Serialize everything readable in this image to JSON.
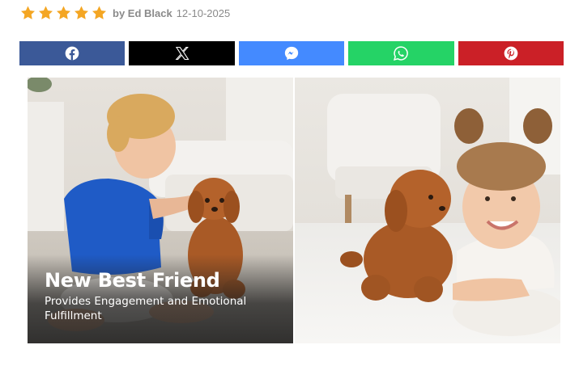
{
  "review": {
    "rating": 5,
    "rating_max": 5,
    "author": "by Ed Black",
    "date": "12-10-2025",
    "star_color": "#f4a623"
  },
  "share": {
    "buttons": [
      {
        "name": "facebook",
        "icon": "facebook-icon",
        "color": "#3b5998"
      },
      {
        "name": "x",
        "icon": "x-icon",
        "color": "#000000"
      },
      {
        "name": "messenger",
        "icon": "messenger-icon",
        "color": "#448aff"
      },
      {
        "name": "whatsapp",
        "icon": "whatsapp-icon",
        "color": "#25d366"
      },
      {
        "name": "pinterest",
        "icon": "pinterest-icon",
        "color": "#cb2027"
      }
    ]
  },
  "hero": {
    "left_image": "boy-playing-with-plush-puppy",
    "right_image": "girl-cuddling-plush-puppy-on-rug",
    "caption": {
      "title": "New Best Friend",
      "subtitle": "Provides Engagement and Emotional Fulfillment"
    }
  }
}
